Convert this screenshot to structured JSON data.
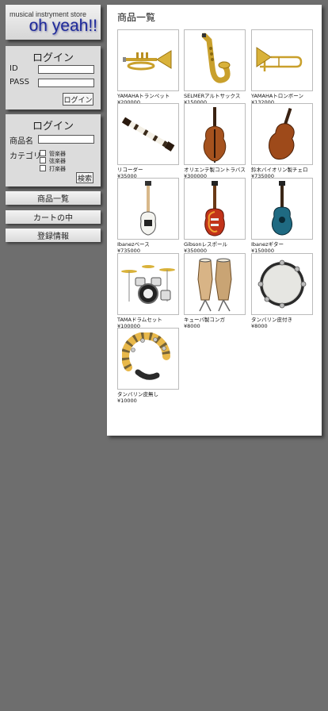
{
  "store": {
    "tagline": "musical instryment store",
    "name": "oh yeah!!"
  },
  "login": {
    "title": "ログイン",
    "id_label": "ID",
    "pass_label": "PASS",
    "button": "ログイン"
  },
  "search": {
    "title": "ログイン",
    "name_label": "商品名",
    "category_label": "カテゴリ",
    "categories": [
      "管楽器",
      "弦楽器",
      "打楽器"
    ],
    "button": "検索"
  },
  "nav": {
    "items": [
      "商品一覧",
      "カートの中",
      "登録情報"
    ]
  },
  "main": {
    "title": "商品一覧",
    "products": [
      {
        "name": "YAMAHAトランペット",
        "price": "¥200000",
        "icon": "trumpet-icon"
      },
      {
        "name": "SELMERアルトサックス",
        "price": "¥150000",
        "icon": "saxophone-icon"
      },
      {
        "name": "YAMAHAトロンボーン",
        "price": "¥132000",
        "icon": "trombone-icon"
      },
      {
        "name": "リコーダー",
        "price": "¥35000",
        "icon": "recorder-icon"
      },
      {
        "name": "オリエンテ製コントラバス",
        "price": "¥300000",
        "icon": "contrabass-icon"
      },
      {
        "name": "鈴木バイオリン製チェロ",
        "price": "¥735000",
        "icon": "cello-icon"
      },
      {
        "name": "Ibanezベース",
        "price": "¥735000",
        "icon": "bass-guitar-icon"
      },
      {
        "name": "Gibsonレスポール",
        "price": "¥350000",
        "icon": "les-paul-icon"
      },
      {
        "name": "Ibanezギター",
        "price": "¥150000",
        "icon": "acoustic-guitar-icon"
      },
      {
        "name": "TAMAドラムセット",
        "price": "¥100000",
        "icon": "drum-kit-icon"
      },
      {
        "name": "キューバ製コンガ",
        "price": "¥8000",
        "icon": "conga-icon"
      },
      {
        "name": "タンバリン皮付き",
        "price": " ¥8000",
        "icon": "tambourine-skin-icon"
      },
      {
        "name": "タンバリン皮無し",
        "price": "¥10000",
        "icon": "tambourine-ring-icon"
      }
    ]
  },
  "colors": {
    "background": "#6e6e6e",
    "panel": "#dcdcdc",
    "logo_text": "#1e2a9a"
  }
}
